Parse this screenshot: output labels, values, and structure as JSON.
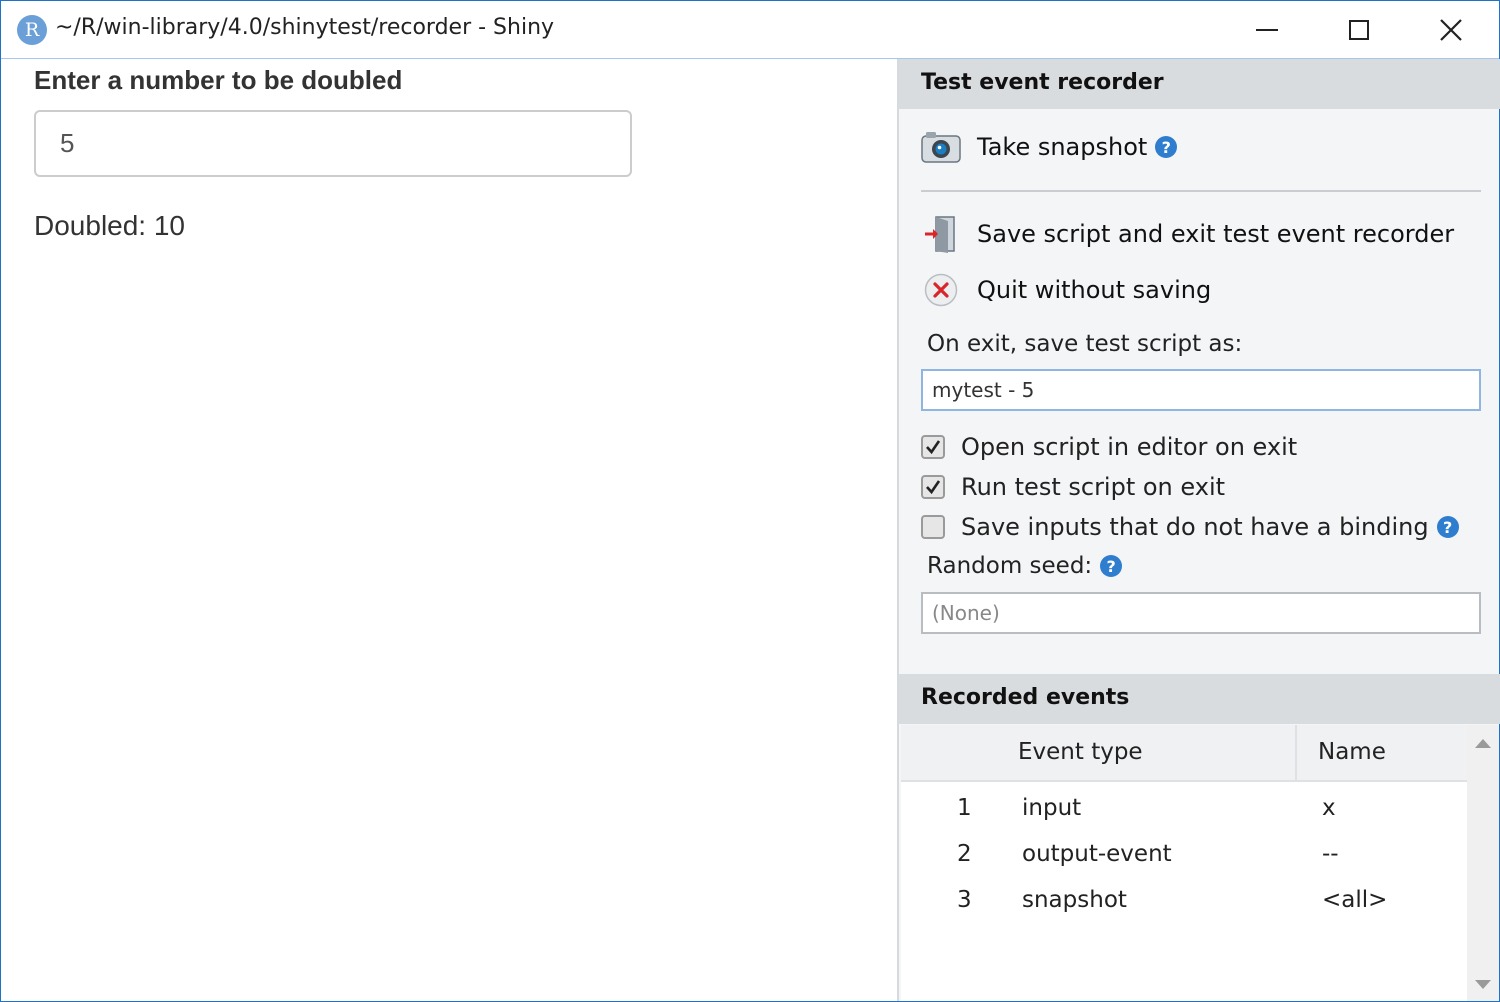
{
  "window": {
    "app_icon_letter": "R",
    "title": "~/R/win-library/4.0/shinytest/recorder - Shiny"
  },
  "app": {
    "number_label": "Enter a number to be doubled",
    "number_value": "5",
    "doubled_text": "Doubled: 10"
  },
  "recorder": {
    "header": "Test event recorder",
    "take_snapshot": "Take snapshot",
    "save_exit": "Save script and exit test event recorder",
    "quit": "Quit without saving",
    "save_as_label": "On exit, save test script as:",
    "save_as_value": "mytest - 5",
    "checkboxes": [
      {
        "label": "Open script in editor on exit",
        "checked": true
      },
      {
        "label": "Run test script on exit",
        "checked": true
      },
      {
        "label": "Save inputs that do not have a binding",
        "checked": false
      }
    ],
    "seed_label": "Random seed:",
    "seed_placeholder": "(None)"
  },
  "events": {
    "header": "Recorded events",
    "columns": [
      "Event type",
      "Name"
    ],
    "rows": [
      {
        "num": "1",
        "type": "input",
        "name": "x"
      },
      {
        "num": "2",
        "type": "output-event",
        "name": "--"
      },
      {
        "num": "3",
        "type": "snapshot",
        "name": "<all>"
      }
    ]
  },
  "icons": {
    "app": "r-logo-icon",
    "minimize": "minimize-icon",
    "maximize": "maximize-icon",
    "close": "close-icon",
    "snapshot": "camera-icon",
    "save_exit": "exit-door-icon",
    "quit": "red-x-icon",
    "help": "help-icon",
    "check": "checkmark-icon"
  },
  "colors": {
    "window_border": "#1e73c8",
    "help_blue": "#2f7dcf",
    "panel_bg": "#f4f5f7",
    "panel_header_bg": "#d9dcdf",
    "quit_red": "#d9262b"
  }
}
